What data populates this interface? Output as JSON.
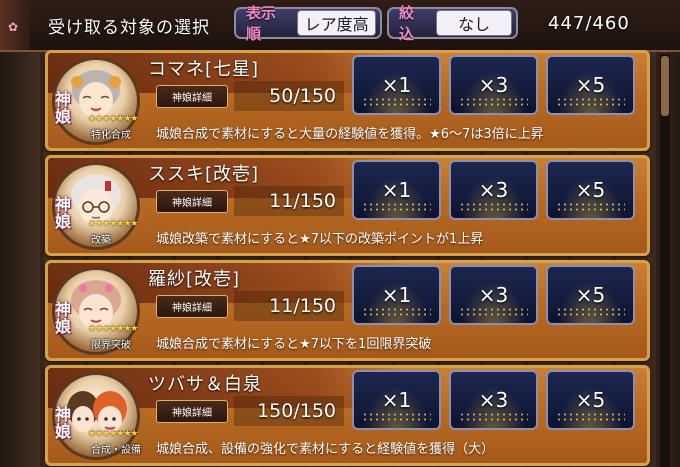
{
  "header": {
    "title": "受け取る対象の選択",
    "sort_label": "表示順",
    "sort_value": "レア度高",
    "filter_label": "絞込",
    "filter_value": "なし",
    "count": "447/460"
  },
  "cards": [
    {
      "name": "コマネ[七星]",
      "badge": "神\n娘",
      "stars": "★★★★★★★",
      "tag": "特化合成",
      "detail_label": "神娘詳細",
      "stock": "50/150",
      "buttons": [
        "×1",
        "×3",
        "×5"
      ],
      "description": "城娘合成で素材にすると大量の経験値を獲得。★6～7は3倍に上昇"
    },
    {
      "name": "ススキ[改壱]",
      "badge": "神\n娘",
      "stars": "★★★★★★★",
      "tag": "改築",
      "detail_label": "神娘詳細",
      "stock": "11/150",
      "buttons": [
        "×1",
        "×3",
        "×5"
      ],
      "description": "城娘改築で素材にすると★7以下の改築ポイントが1上昇"
    },
    {
      "name": "羅紗[改壱]",
      "badge": "神\n娘",
      "stars": "★★★★★★★",
      "tag": "限界突破",
      "detail_label": "神娘詳細",
      "stock": "11/150",
      "buttons": [
        "×1",
        "×3",
        "×5"
      ],
      "description": "城娘合成で素材にすると★7以下を1回限界突破"
    },
    {
      "name": "ツバサ＆白泉",
      "badge": "神\n娘",
      "stars": "★★★★★★★",
      "tag": "合成・設備",
      "detail_label": "神娘詳細",
      "stock": "150/150",
      "buttons": [
        "×1",
        "×3",
        "×5"
      ],
      "description": "城娘合成、設備の強化で素材にすると経験値を獲得（大）"
    }
  ],
  "colors": {
    "card_orange": "#b86a22",
    "card_border": "#d9a04a",
    "button_navy": "#1c2650",
    "badge_pink": "#f08ac0",
    "star_gold": "#ffd23a"
  }
}
